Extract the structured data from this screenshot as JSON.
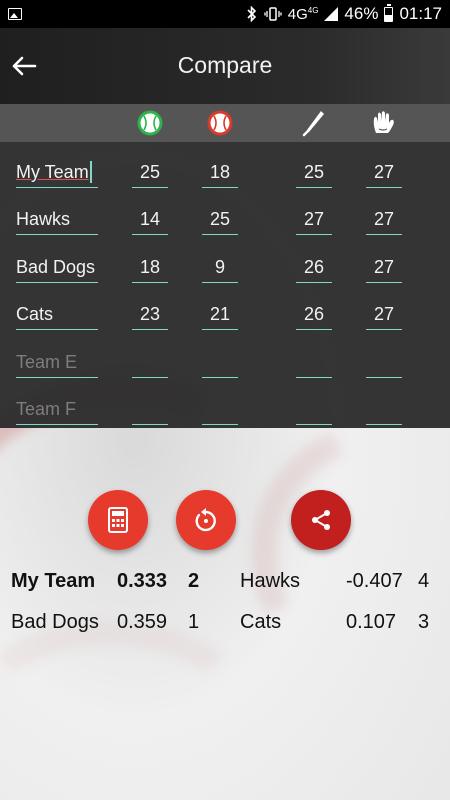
{
  "status": {
    "network": "4G",
    "network_small": "4G",
    "battery": "46%",
    "time": "01:17"
  },
  "app_bar": {
    "title": "Compare",
    "back_icon": "back-arrow-icon"
  },
  "columns": [
    {
      "icon": "baseball-green-icon",
      "color": "#2db34a"
    },
    {
      "icon": "baseball-red-icon",
      "color": "#d83a2e"
    },
    {
      "icon": "bat-icon",
      "color": "#ffffff"
    },
    {
      "icon": "glove-icon",
      "color": "#ffffff"
    }
  ],
  "teams": [
    {
      "name": "My Team",
      "v1": "25",
      "v2": "18",
      "v3": "25",
      "v4": "27"
    },
    {
      "name": "Hawks",
      "v1": "14",
      "v2": "25",
      "v3": "27",
      "v4": "27"
    },
    {
      "name": "Bad Dogs",
      "v1": "18",
      "v2": "9",
      "v3": "26",
      "v4": "27"
    },
    {
      "name": "Cats",
      "v1": "23",
      "v2": "21",
      "v3": "26",
      "v4": "27"
    },
    {
      "name_placeholder": "Team E",
      "v1": "",
      "v2": "",
      "v3": "",
      "v4": ""
    },
    {
      "name_placeholder": "Team F",
      "v1": "",
      "v2": "",
      "v3": "",
      "v4": ""
    }
  ],
  "actions": [
    {
      "icon": "calculator-icon",
      "color": "#e53a2c"
    },
    {
      "icon": "reset-icon",
      "color": "#e53a2c"
    },
    {
      "icon": "share-icon",
      "color": "#c21f1f"
    }
  ],
  "results": [
    {
      "team": "My Team",
      "score": "0.333",
      "rank": "2",
      "bold": true
    },
    {
      "team": "Hawks",
      "score": "-0.407",
      "rank": "4",
      "bold": false
    },
    {
      "team": "Bad Dogs",
      "score": "0.359",
      "rank": "1",
      "bold": false
    },
    {
      "team": "Cats",
      "score": "0.107",
      "rank": "3",
      "bold": false
    }
  ]
}
